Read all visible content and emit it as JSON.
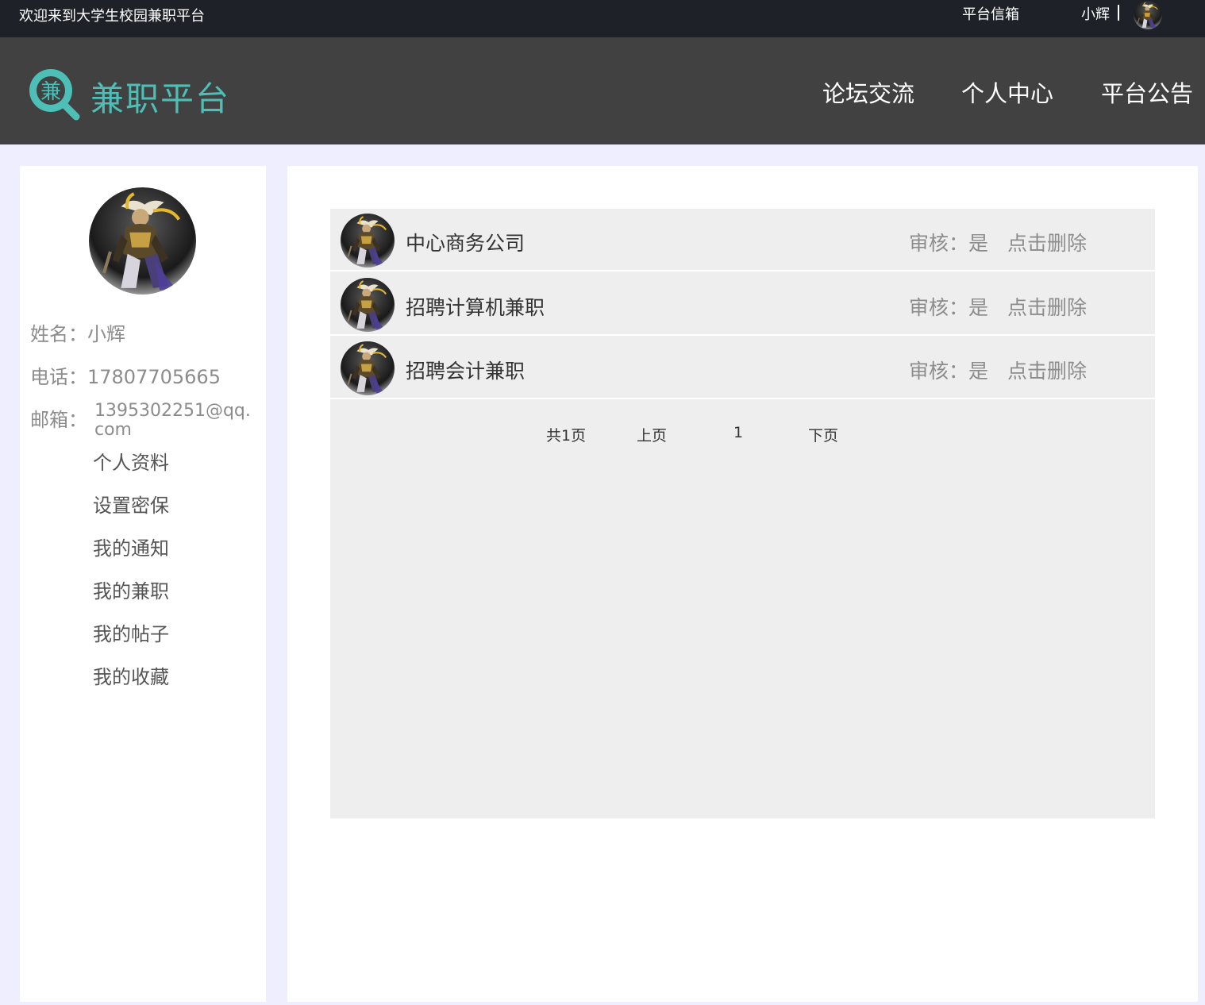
{
  "topbar": {
    "welcome": "欢迎来到大学生校园兼职平台",
    "mailbox": "平台信箱",
    "username": "小辉"
  },
  "header": {
    "logo_char": "兼",
    "logo_text": "兼职平台",
    "nav": [
      "论坛交流",
      "个人中心",
      "平台公告"
    ]
  },
  "profile": {
    "name_label": "姓名：",
    "name": "小辉",
    "phone_label": "电话：",
    "phone": "17807705665",
    "email_label": "邮箱：",
    "email": "1395302251@qq.com"
  },
  "menu": [
    "个人资料",
    "设置密保",
    "我的通知",
    "我的兼职",
    "我的帖子",
    "我的收藏"
  ],
  "jobs": [
    {
      "title": "中心商务公司",
      "audit": "审核：是",
      "action": "点击删除"
    },
    {
      "title": "招聘计算机兼职",
      "audit": "审核：是",
      "action": "点击删除"
    },
    {
      "title": "招聘会计兼职",
      "audit": "审核：是",
      "action": "点击删除"
    }
  ],
  "pager": {
    "total": "共1页",
    "prev": "上页",
    "current": "1",
    "next": "下页"
  },
  "colors": {
    "topbar_bg": "#1e2127",
    "header_bg": "#414141",
    "brand": "#4dbfb6",
    "page_bg": "#efeefe",
    "list_bg": "#eeeeee"
  }
}
